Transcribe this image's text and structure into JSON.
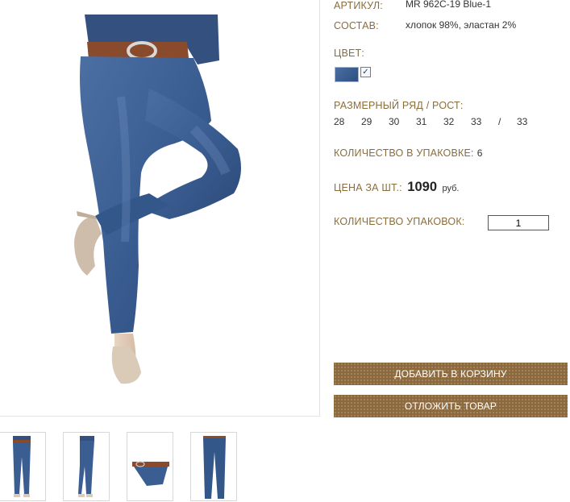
{
  "product": {
    "article_label": "АРТИКУЛ:",
    "article_value": "MR 962C-19 Blue-1",
    "composition_label": "СОСТАВ:",
    "composition_value": "хлопок 98%, эластан 2%",
    "color_label": "ЦВЕТ:",
    "color_swatch": "#3c5f93",
    "sizes_label": "РАЗМЕРНЫЙ РЯД / РОСТ:",
    "sizes": [
      "28",
      "29",
      "30",
      "31",
      "32",
      "33",
      "/",
      "33"
    ],
    "pack_qty_label": "КОЛИЧЕСТВО В УПАКОВКЕ:",
    "pack_qty_value": "6",
    "price_label": "ЦЕНА ЗА ШТ.:",
    "price_value": "1090",
    "price_currency": "руб.",
    "packs_label": "КОЛИЧЕСТВО УПАКОВОК:",
    "packs_value": "1"
  },
  "actions": {
    "add_to_cart": "ДОБАВИТЬ В КОРЗИНУ",
    "save_item": "ОТЛОЖИТЬ ТОВАР"
  },
  "colors": {
    "accent": "#8d6a3d",
    "label": "#8a6d3b",
    "denim": "#3c5f93"
  }
}
